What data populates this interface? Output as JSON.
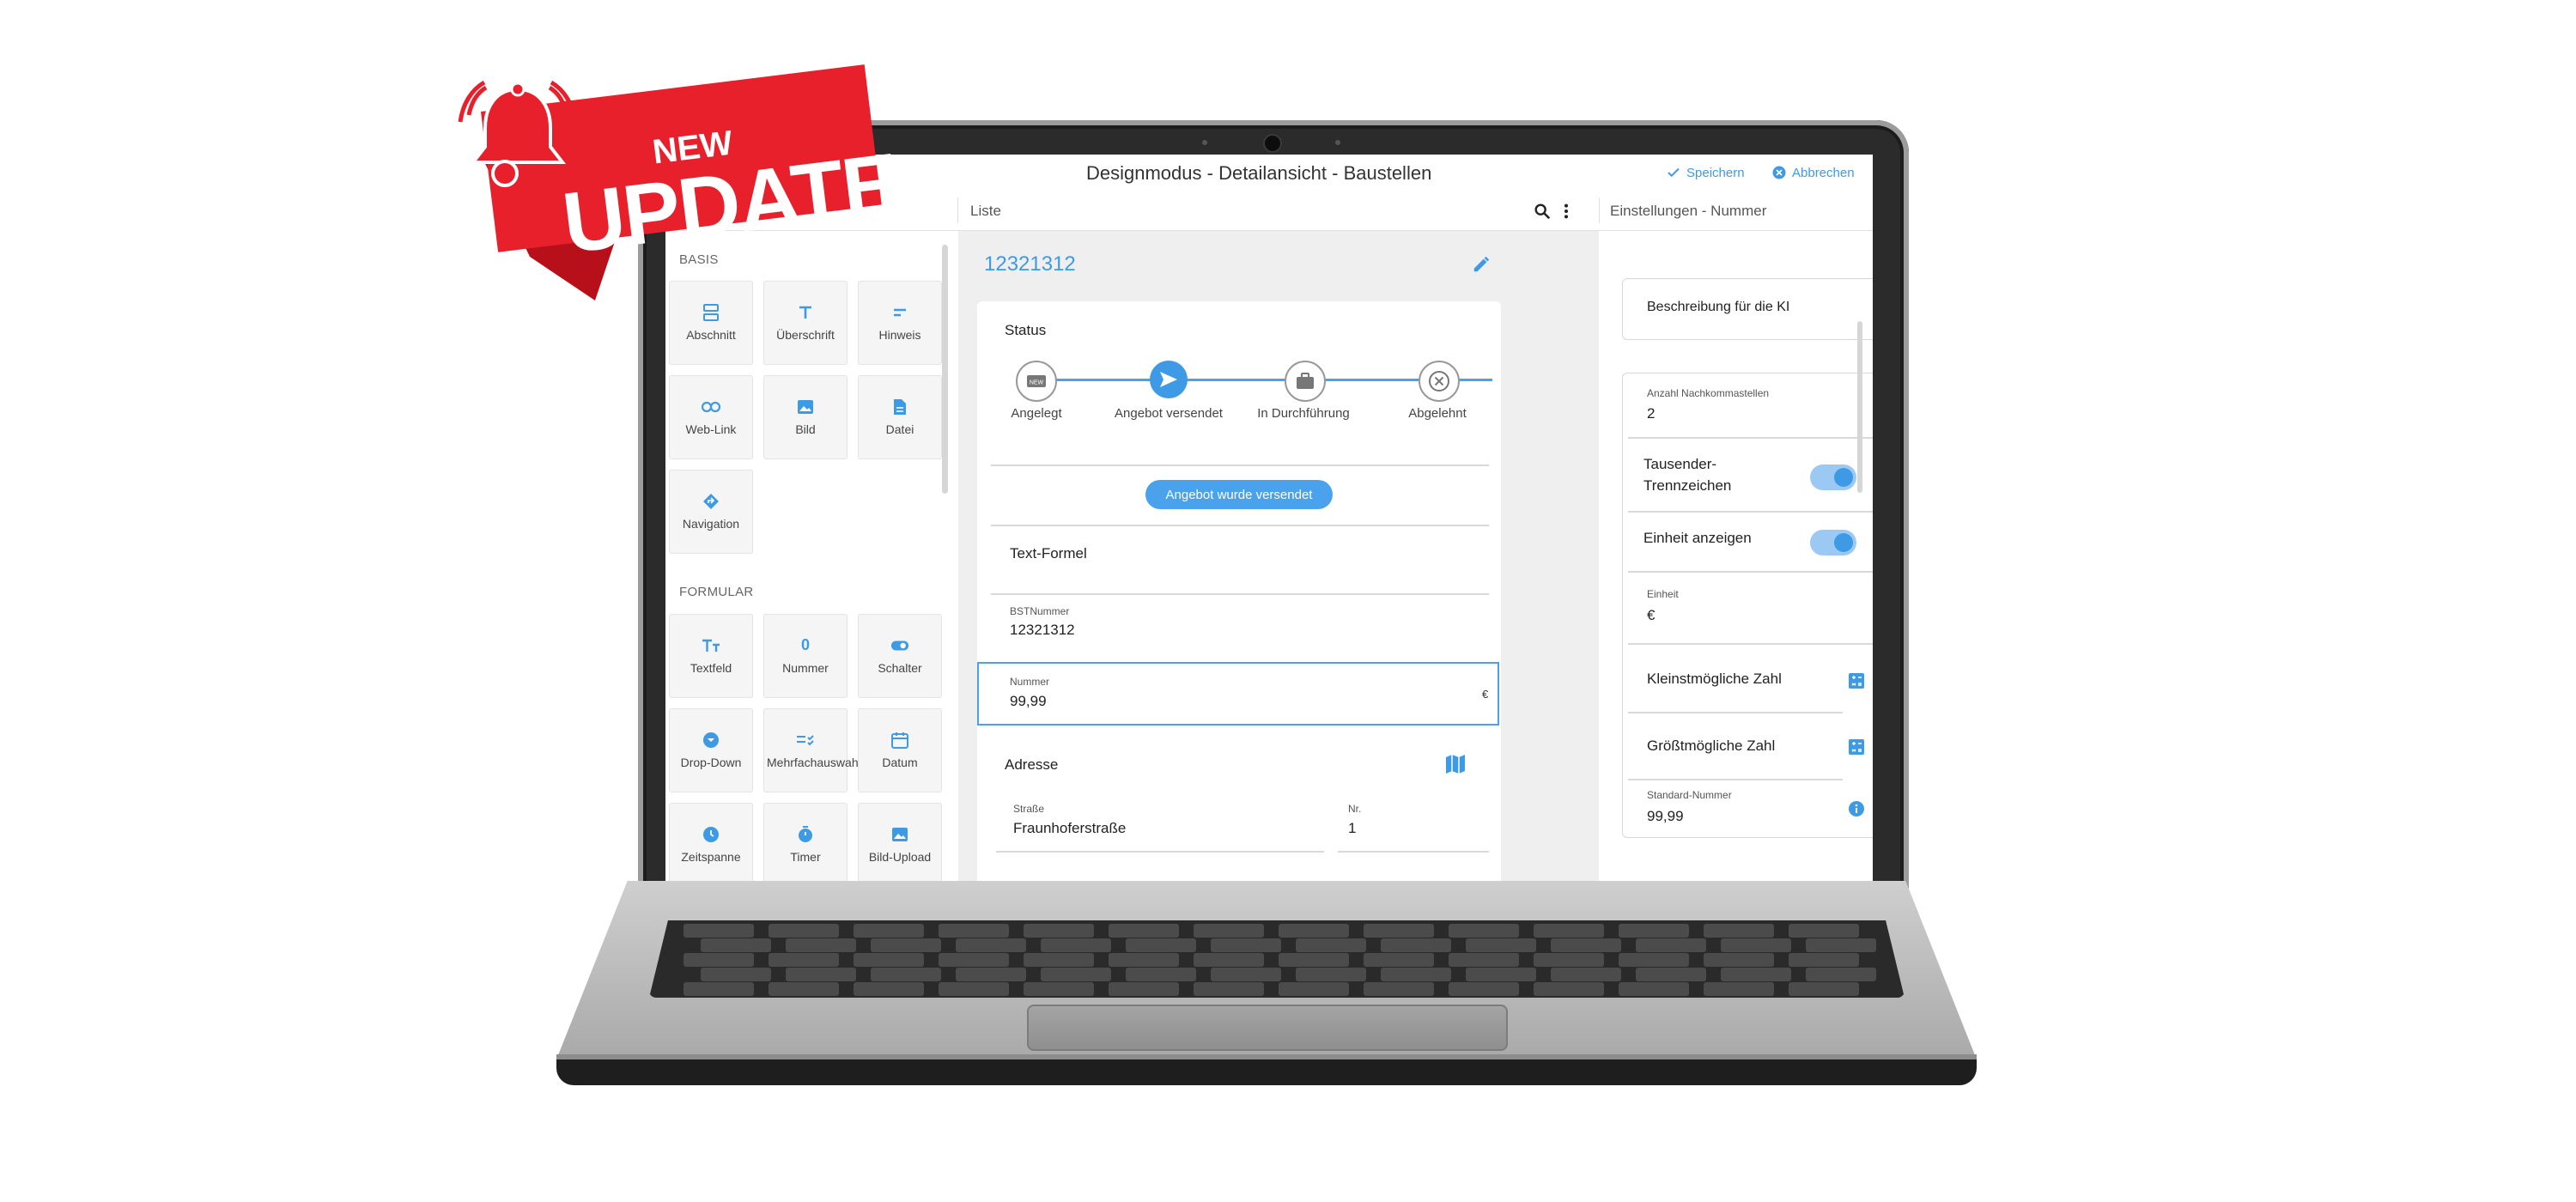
{
  "window": {
    "title": "Designmodus - Detailansicht - Baustellen",
    "save_label": "Speichern",
    "cancel_label": "Abbrechen"
  },
  "toolbar": {
    "list_label": "Liste",
    "settings_title": "Einstellungen - Nummer"
  },
  "left_panel": {
    "sections": [
      {
        "title": "BASIS",
        "items": [
          "Abschnitt",
          "Überschrift",
          "Hinweis",
          "Web-Link",
          "Bild",
          "Datei",
          "Navigation"
        ]
      },
      {
        "title": "FORMULAR",
        "items": [
          "Textfeld",
          "Nummer",
          "Schalter",
          "Drop-Down",
          "Mehrfachauswahl",
          "Datum",
          "Zeitspanne",
          "Timer",
          "Bild-Upload"
        ]
      }
    ],
    "number_icon_glyph": "0"
  },
  "record": {
    "heading": "12321312",
    "status_label": "Status",
    "steps": [
      "Angelegt",
      "Angebot versendet",
      "In Durchführung",
      "Abgelehnt"
    ],
    "active_step": 1,
    "status_button": "Angebot wurde versendet",
    "text_formula_label": "Text-Formel",
    "bst_label": "BSTNummer",
    "bst_value": "12321312",
    "number_label": "Nummer",
    "number_value": "99,99",
    "number_unit": "€",
    "address_label": "Adresse",
    "street_label": "Straße",
    "street_value": "Fraunhoferstraße",
    "nr_label": "Nr.",
    "nr_value": "1"
  },
  "settings": {
    "ai_description": "Beschreibung für die KI",
    "decimals_label": "Anzahl Nachkommastellen",
    "decimals_value": "2",
    "thousand_sep_label": "Tausender-Trennzeichen",
    "thousand_sep_on": true,
    "show_unit_label": "Einheit anzeigen",
    "show_unit_on": true,
    "unit_label": "Einheit",
    "unit_value": "€",
    "min_label": "Kleinstmögliche Zahl",
    "max_label": "Größtmögliche Zahl",
    "default_label": "Standard-Nummer",
    "default_value": "99,99"
  },
  "badge": {
    "line1": "NEW",
    "line2": "UPDATE"
  },
  "colors": {
    "accent": "#3f9ae6",
    "badge_red": "#e8202c"
  }
}
